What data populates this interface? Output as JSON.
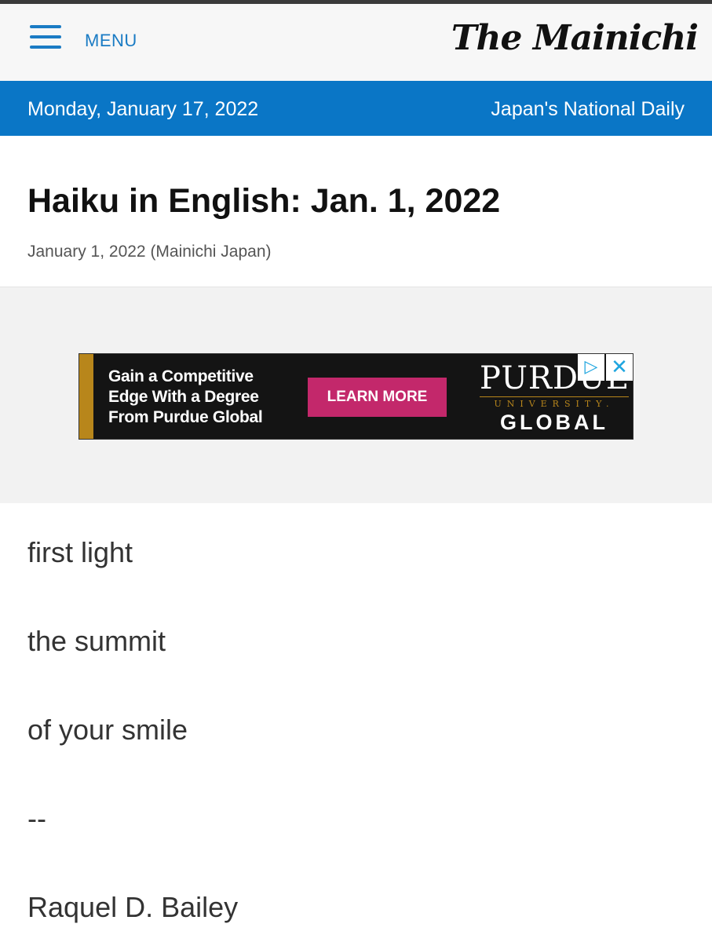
{
  "header": {
    "menu_label": "MENU",
    "brand": "The Mainichi"
  },
  "datebar": {
    "date": "Monday, January 17, 2022",
    "tagline": "Japan's National Daily"
  },
  "article": {
    "title": "Haiku in English: Jan. 1, 2022",
    "byline": "January 1, 2022 (Mainichi Japan)",
    "lines": [
      "first light",
      "the summit",
      "of your smile",
      "--",
      "Raquel D. Bailey"
    ]
  },
  "ad": {
    "copy": "Gain a Competitive Edge With a Degree From Purdue Global",
    "cta": "LEARN MORE",
    "logo_main": "PURDUE",
    "logo_sub": "UNIVERSITY.",
    "logo_global": "GLOBAL",
    "adchoice_icon": "▷",
    "close_icon": "✕"
  },
  "colors": {
    "accent": "#0a76c6",
    "cta": "#c3286b",
    "ad_gold": "#b8861b"
  }
}
